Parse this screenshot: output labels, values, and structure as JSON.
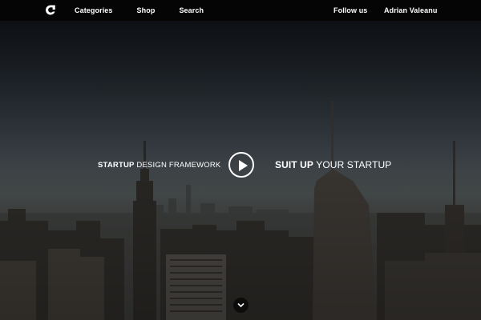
{
  "nav": {
    "logo_icon": "c-logo-icon",
    "left_links": [
      "Categories",
      "Shop",
      "Search"
    ],
    "follow_label": "Follow us",
    "user_name": "Adrian Valeanu"
  },
  "hero": {
    "left_tag_bold": "STARTUP",
    "left_tag_rest": " DESIGN FRAMEWORK",
    "right_tag_bold": "SUIT UP",
    "right_tag_rest": " YOUR STARTUP",
    "play_icon": "play-icon",
    "scroll_icon": "chevron-down-icon",
    "background": "city-skyline-photo"
  }
}
